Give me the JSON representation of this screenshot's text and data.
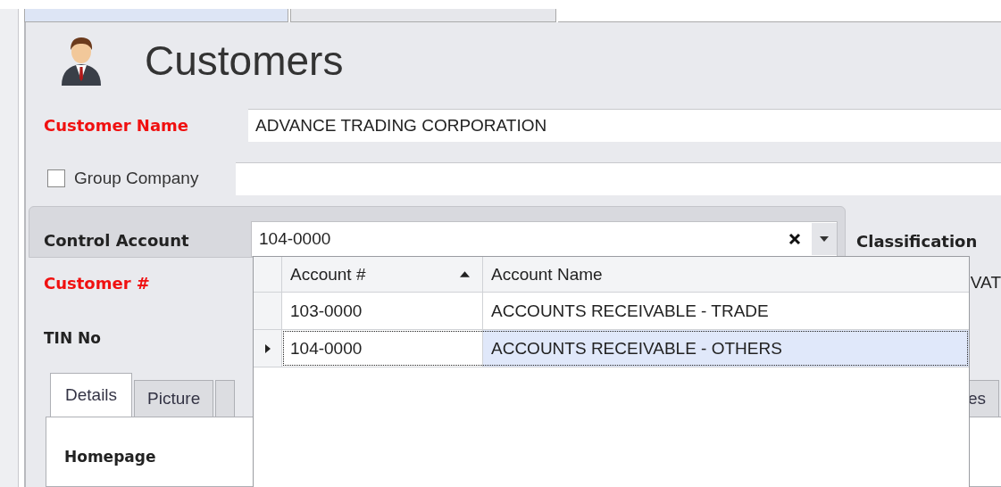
{
  "document_tabs": [
    {
      "selected": true
    },
    {
      "selected": false
    }
  ],
  "title": "Customers",
  "customer_name": {
    "label": "Customer Name",
    "required": true,
    "value": "ADVANCE TRADING CORPORATION"
  },
  "group_company": {
    "label": "Group Company",
    "checked": false
  },
  "control_account": {
    "label": "Control Account",
    "value": "104-0000"
  },
  "classification": {
    "label": "Classification"
  },
  "customer_number": {
    "label": "Customer #",
    "required": true
  },
  "partial_text": "VAT",
  "tin_no": {
    "label": "TIN No",
    "required": false
  },
  "tabs": [
    {
      "label": "Details",
      "selected": true
    },
    {
      "label": "Picture",
      "selected": false
    },
    {
      "selected": false
    },
    {
      "label": "es",
      "selected": false
    }
  ],
  "homepage": {
    "label": "Homepage"
  },
  "account_dropdown": {
    "columns": [
      {
        "label": "Account #",
        "sorted_ascending": true
      },
      {
        "label": "Account Name"
      }
    ],
    "rows": [
      {
        "account": "103-0000",
        "name": "ACCOUNTS RECEIVABLE - TRADE",
        "selected": false
      },
      {
        "account": "104-0000",
        "name": "ACCOUNTS RECEIVABLE - OTHERS",
        "selected": true
      }
    ]
  }
}
